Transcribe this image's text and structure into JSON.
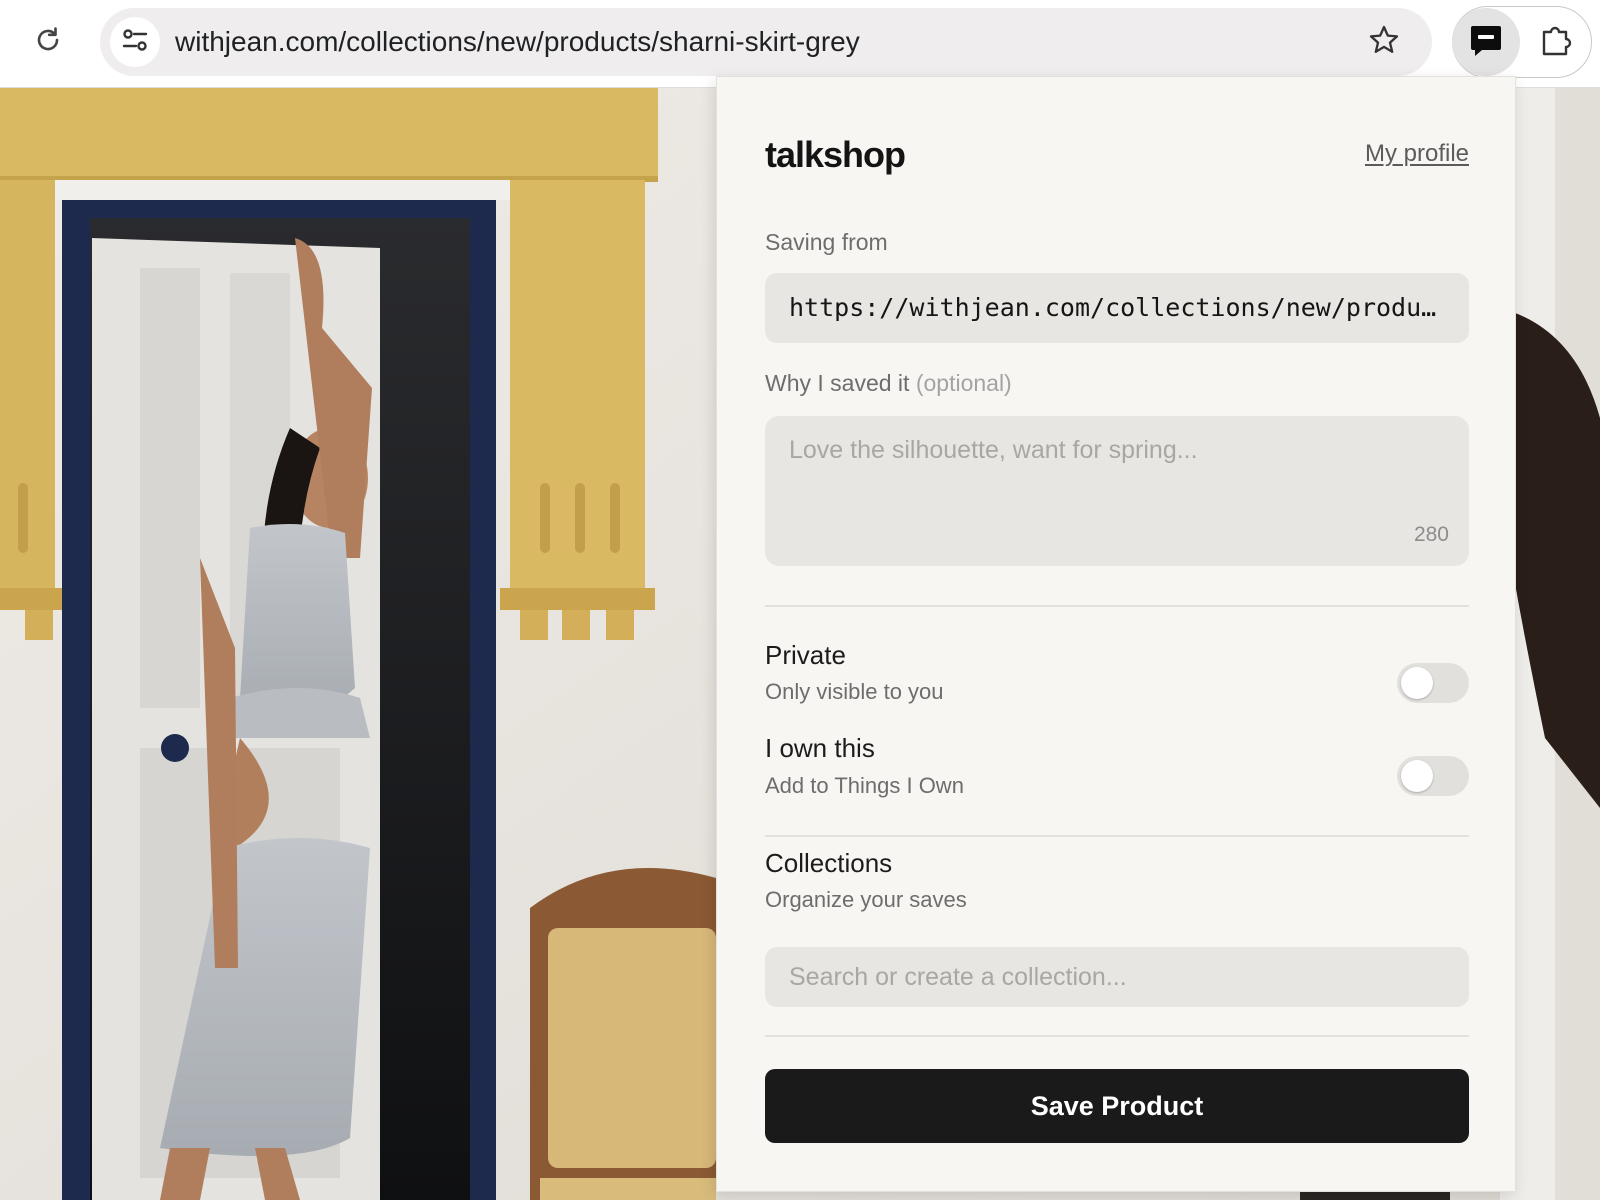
{
  "browser": {
    "url": "withjean.com/collections/new/products/sharni-skirt-grey",
    "icons": {
      "reload": "reload-icon",
      "site_info": "tune-icon",
      "bookmark": "star-icon",
      "extension": "chat-bubble-icon",
      "extensions_menu": "puzzle-icon"
    }
  },
  "popup": {
    "brand": "talkshop",
    "profile_link": "My profile",
    "saving_from_label": "Saving from",
    "source_url": "https://withjean.com/collections/new/products/sharni-skirt-grey",
    "why_label": "Why I saved it",
    "why_optional": "(optional)",
    "why_placeholder": "Love the silhouette, want for spring...",
    "why_char_count": "280",
    "private": {
      "title": "Private",
      "subtitle": "Only visible to you",
      "enabled": false
    },
    "own": {
      "title": "I own this",
      "subtitle": "Add to Things I Own",
      "enabled": false
    },
    "collections": {
      "title": "Collections",
      "subtitle": "Organize your saves",
      "placeholder": "Search or create a collection..."
    },
    "save_button": "Save Product"
  },
  "colors": {
    "popup_bg": "#f8f6f3",
    "field_bg": "#e8e6e3",
    "button_bg": "#1a1a1a",
    "accent_yellow": "#d9bb62",
    "door_blue": "#1d2a4d",
    "garment_grey": "#b3b8bd"
  }
}
